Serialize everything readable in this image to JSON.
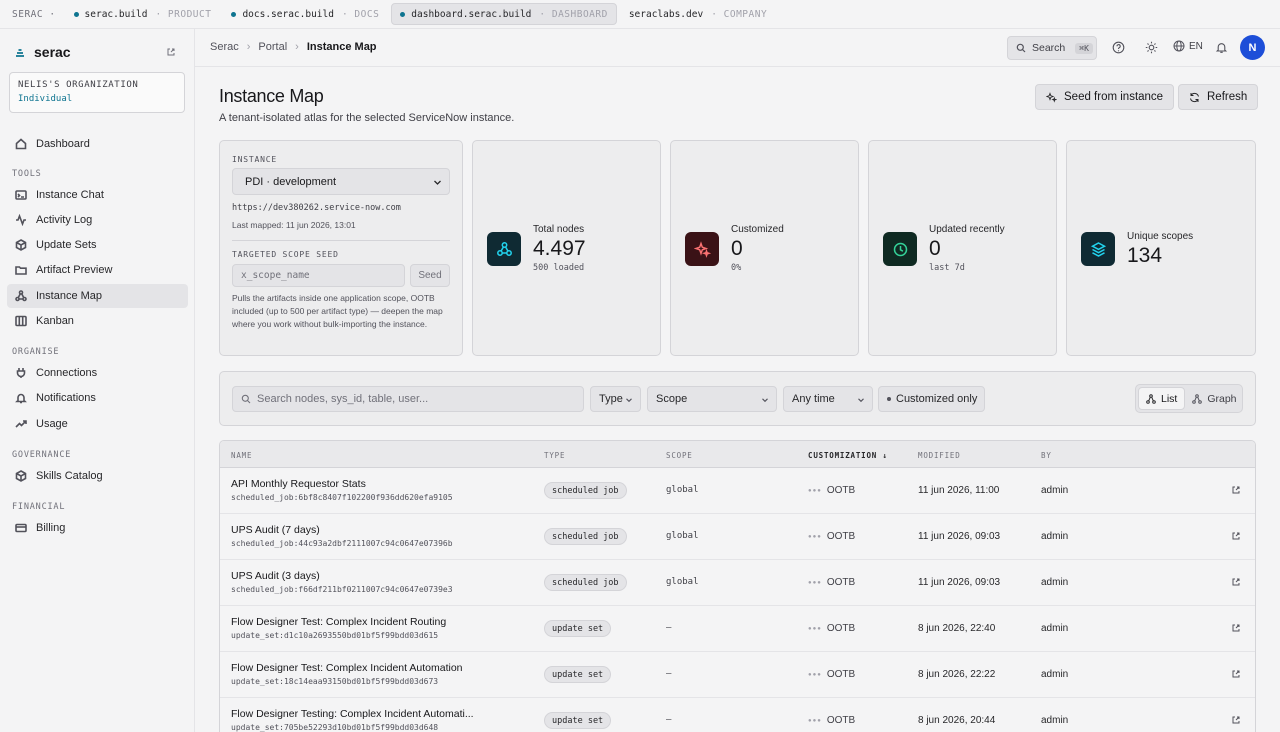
{
  "topstrip": {
    "brand": "SERAC ·",
    "tabs": [
      {
        "label": "serac.build",
        "sub": "· PRODUCT"
      },
      {
        "label": "docs.serac.build",
        "sub": "· DOCS"
      },
      {
        "label": "dashboard.serac.build",
        "sub": "· DASHBOARD"
      },
      {
        "label": "seraclabs.dev",
        "sub": "· COMPANY"
      }
    ]
  },
  "sidebar": {
    "logo": "serac",
    "org": {
      "name": "NELIS'S ORGANIZATION",
      "tier": "Individual"
    },
    "dashboard": "Dashboard",
    "sections": {
      "tools": "TOOLS",
      "organise": "ORGANISE",
      "governance": "GOVERNANCE",
      "financial": "FINANCIAL"
    },
    "items": {
      "instance_chat": "Instance Chat",
      "activity_log": "Activity Log",
      "update_sets": "Update Sets",
      "artifact_preview": "Artifact Preview",
      "instance_map": "Instance Map",
      "kanban": "Kanban",
      "connections": "Connections",
      "notifications": "Notifications",
      "usage": "Usage",
      "skills_catalog": "Skills Catalog",
      "billing": "Billing"
    }
  },
  "header": {
    "breadcrumb": [
      "Serac",
      "Portal",
      "Instance Map"
    ],
    "search": "Search",
    "shortcut": "⌘K",
    "lang": "EN",
    "avatar": "N"
  },
  "page": {
    "title": "Instance Map",
    "subtitle": "A tenant-isolated atlas for the selected ServiceNow instance.",
    "seed_button": "Seed from instance",
    "refresh_button": "Refresh"
  },
  "instance_card": {
    "label": "INSTANCE",
    "selected": "PDI · development",
    "url": "https://dev380262.service-now.com",
    "last_mapped": "Last mapped: 11 jun 2026, 13:01",
    "seed_label": "TARGETED SCOPE SEED",
    "seed_placeholder": "x_scope_name",
    "seed_button": "Seed",
    "hint": "Pulls the artifacts inside one application scope, OOTB included (up to 500 per artifact type) — deepen the map where you work without bulk-importing the instance."
  },
  "stats": [
    {
      "label": "Total nodes",
      "value": "4.497",
      "sub": "500 loaded",
      "color": "#0e7490",
      "bg": "#0f2a33"
    },
    {
      "label": "Customized",
      "value": "0",
      "sub": "0%",
      "color": "#f87171",
      "bg": "#3a1216"
    },
    {
      "label": "Updated recently",
      "value": "0",
      "sub": "last 7d",
      "color": "#34d399",
      "bg": "#0f2a22"
    },
    {
      "label": "Unique scopes",
      "value": "134",
      "sub": "",
      "color": "#22d3ee",
      "bg": "#0f2a33"
    }
  ],
  "filters": {
    "search_placeholder": "Search nodes, sys_id, table, user...",
    "type": "Type",
    "scope": "Scope",
    "time": "Any time",
    "customized": "Customized only",
    "view_list": "List",
    "view_graph": "Graph"
  },
  "table": {
    "headers": {
      "name": "NAME",
      "type": "TYPE",
      "scope": "SCOPE",
      "customization": "CUSTOMIZATION ↓",
      "modified": "MODIFIED",
      "by": "BY"
    },
    "rows": [
      {
        "name": "API Monthly Requestor Stats",
        "id": "scheduled_job:6bf8c8407f102200f936dd620efa9105",
        "type": "scheduled job",
        "scope": "global",
        "cust": "OOTB",
        "modified": "11 jun 2026, 11:00",
        "by": "admin"
      },
      {
        "name": "UPS Audit (7 days)",
        "id": "scheduled_job:44c93a2dbf2111007c94c0647e07396b",
        "type": "scheduled job",
        "scope": "global",
        "cust": "OOTB",
        "modified": "11 jun 2026, 09:03",
        "by": "admin"
      },
      {
        "name": "UPS Audit (3 days)",
        "id": "scheduled_job:f66df211bf0211007c94c0647e0739e3",
        "type": "scheduled job",
        "scope": "global",
        "cust": "OOTB",
        "modified": "11 jun 2026, 09:03",
        "by": "admin"
      },
      {
        "name": "Flow Designer Test: Complex Incident Routing",
        "id": "update_set:d1c10a2693550bd01bf5f99bdd03d615",
        "type": "update set",
        "scope": "—",
        "cust": "OOTB",
        "modified": "8 jun 2026, 22:40",
        "by": "admin"
      },
      {
        "name": "Flow Designer Test: Complex Incident Automation",
        "id": "update_set:18c14eaa93150bd01bf5f99bdd03d673",
        "type": "update set",
        "scope": "—",
        "cust": "OOTB",
        "modified": "8 jun 2026, 22:22",
        "by": "admin"
      },
      {
        "name": "Flow Designer Testing: Complex Incident Automati...",
        "id": "update_set:705be52293d10bd01bf5f99bdd03d648",
        "type": "update set",
        "scope": "—",
        "cust": "OOTB",
        "modified": "8 jun 2026, 20:44",
        "by": "admin"
      }
    ]
  }
}
